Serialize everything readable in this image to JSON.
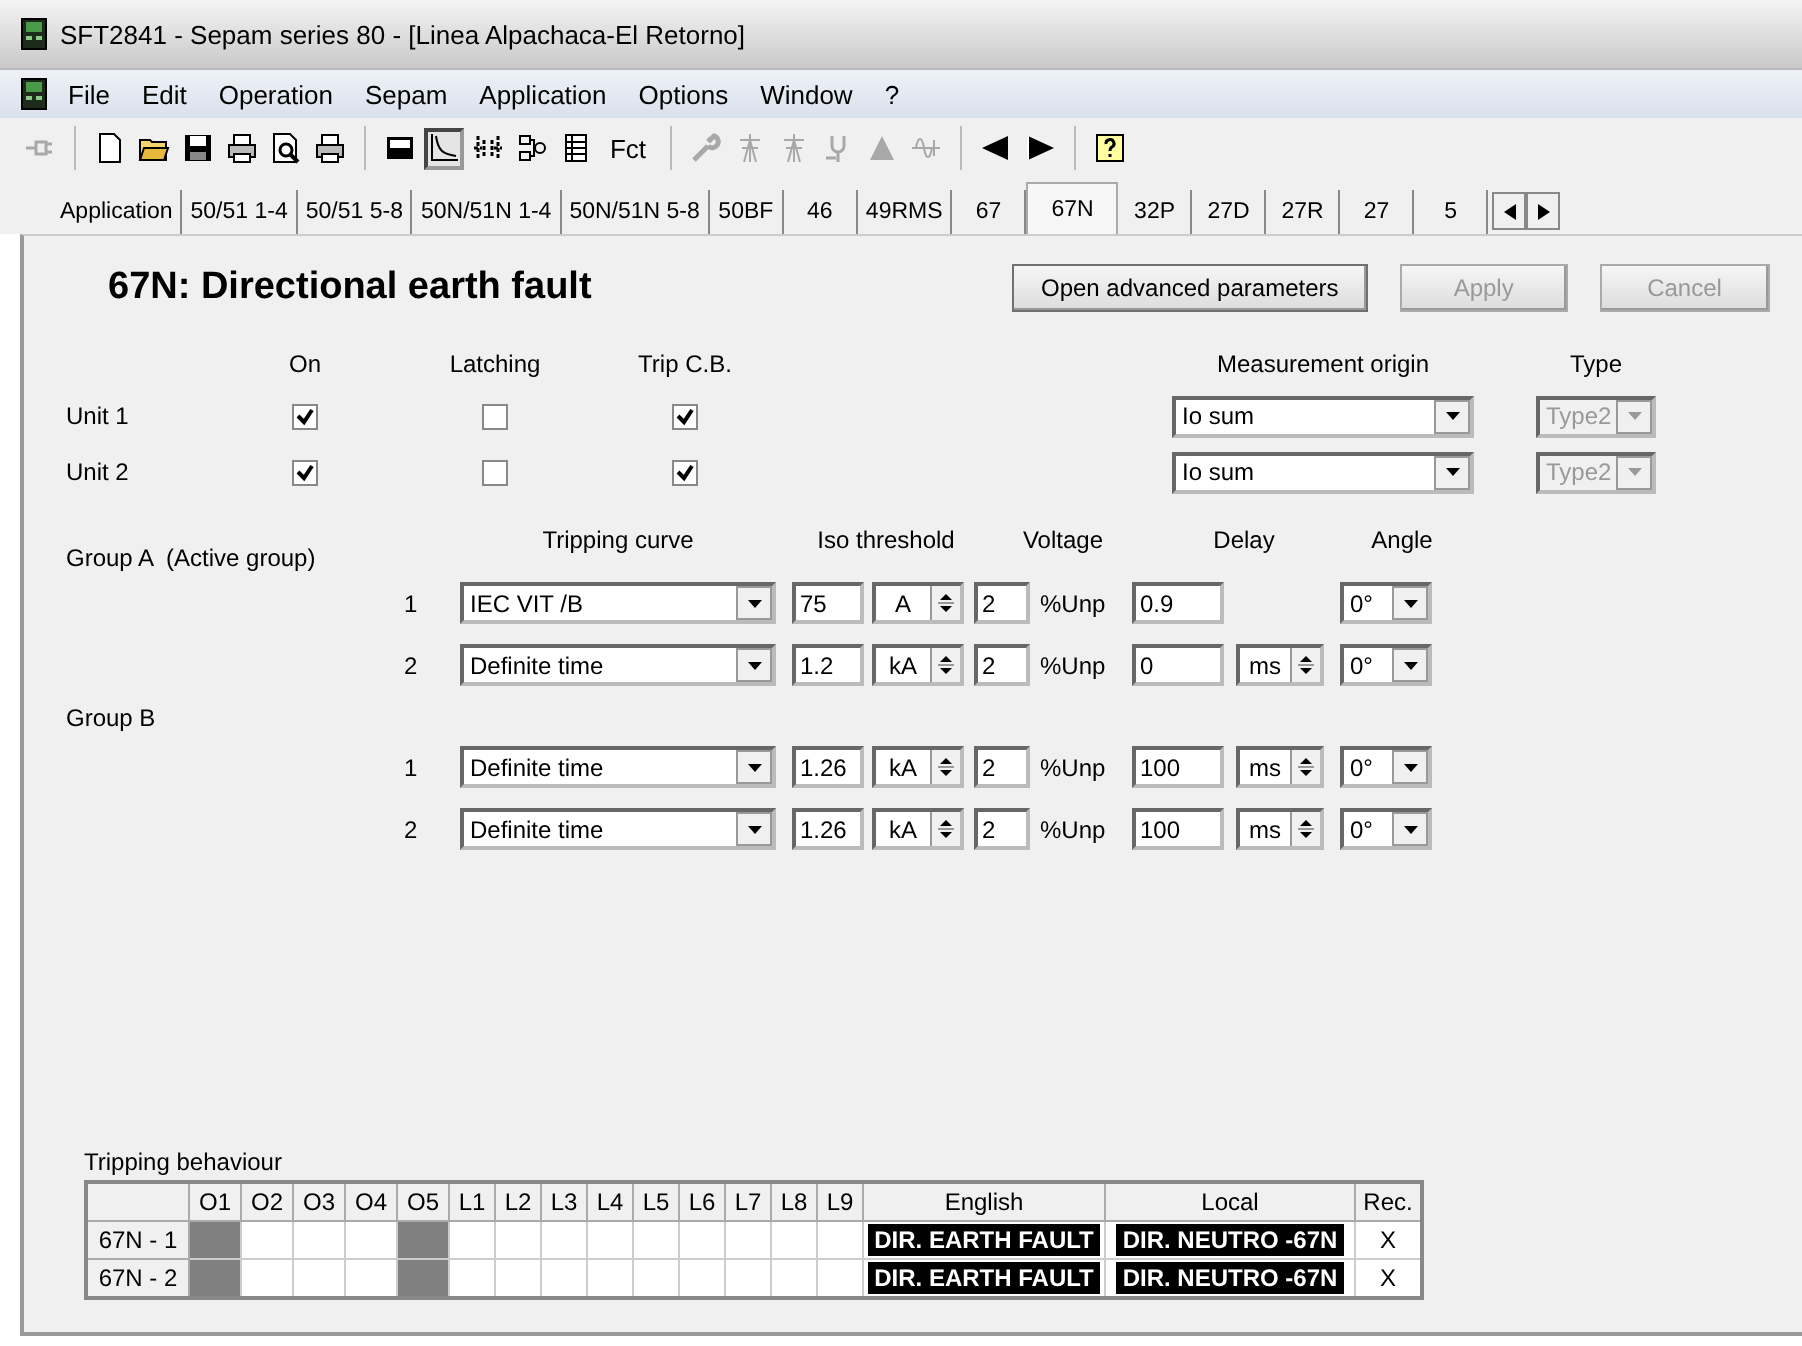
{
  "window": {
    "title": "SFT2841 - Sepam series 80 - [Linea Alpachaca-El Retorno]"
  },
  "menu": [
    "File",
    "Edit",
    "Operation",
    "Sepam",
    "Application",
    "Options",
    "Window",
    "?"
  ],
  "toolbar": [
    {
      "kind": "plug",
      "disabled": true,
      "selected": false
    },
    {
      "kind": "separator"
    },
    {
      "kind": "new",
      "disabled": false,
      "selected": false
    },
    {
      "kind": "open",
      "disabled": false,
      "selected": false
    },
    {
      "kind": "save",
      "disabled": false,
      "selected": false
    },
    {
      "kind": "print",
      "disabled": false,
      "selected": false
    },
    {
      "kind": "preview",
      "disabled": false,
      "selected": false
    },
    {
      "kind": "print",
      "disabled": false,
      "selected": false
    },
    {
      "kind": "separator"
    },
    {
      "kind": "device",
      "disabled": false,
      "selected": false
    },
    {
      "kind": "curve",
      "disabled": false,
      "selected": true
    },
    {
      "kind": "io",
      "disabled": false,
      "selected": false
    },
    {
      "kind": "logic",
      "disabled": false,
      "selected": false
    },
    {
      "kind": "table",
      "disabled": false,
      "selected": false
    },
    {
      "kind": "text",
      "label": "Fct",
      "disabled": false,
      "selected": false
    },
    {
      "kind": "separator"
    },
    {
      "kind": "wrench",
      "disabled": true,
      "selected": false
    },
    {
      "kind": "tower",
      "disabled": true,
      "selected": false
    },
    {
      "kind": "tower",
      "disabled": true,
      "selected": false
    },
    {
      "kind": "probe",
      "disabled": true,
      "selected": false
    },
    {
      "kind": "triangle",
      "disabled": true,
      "selected": false
    },
    {
      "kind": "wave",
      "disabled": true,
      "selected": false
    },
    {
      "kind": "separator"
    },
    {
      "kind": "back",
      "disabled": false,
      "selected": false
    },
    {
      "kind": "forward",
      "disabled": false,
      "selected": false
    },
    {
      "kind": "separator"
    },
    {
      "kind": "help",
      "disabled": false,
      "selected": false
    }
  ],
  "tabs": [
    {
      "label": "Application",
      "selected": false
    },
    {
      "label": "50/51 1-4",
      "selected": false
    },
    {
      "label": "50/51 5-8",
      "selected": false
    },
    {
      "label": "50N/51N 1-4",
      "selected": false
    },
    {
      "label": "50N/51N 5-8",
      "selected": false
    },
    {
      "label": "50BF",
      "selected": false
    },
    {
      "label": "46",
      "selected": false
    },
    {
      "label": "49RMS",
      "selected": false
    },
    {
      "label": "67",
      "selected": false
    },
    {
      "label": "67N",
      "selected": true
    },
    {
      "label": "32P",
      "selected": false
    },
    {
      "label": "27D",
      "selected": false
    },
    {
      "label": "27R",
      "selected": false
    },
    {
      "label": "27",
      "selected": false
    },
    {
      "label": "5",
      "selected": false
    }
  ],
  "panel": {
    "heading": "67N: Directional earth fault",
    "buttons": [
      {
        "label": "Open advanced parameters",
        "disabled": false
      },
      {
        "label": "Apply",
        "disabled": true
      },
      {
        "label": "Cancel",
        "disabled": true
      }
    ],
    "unit_columns": [
      "On",
      "Latching",
      "Trip C.B."
    ],
    "origin_header": "Measurement origin",
    "type_header": "Type",
    "units": [
      {
        "label": "Unit 1",
        "on": true,
        "latching": false,
        "trip_cb": true,
        "measurement_origin": "Io sum",
        "type": {
          "value": "Type2",
          "disabled": true
        }
      },
      {
        "label": "Unit 2",
        "on": true,
        "latching": false,
        "trip_cb": true,
        "measurement_origin": "Io sum",
        "type": {
          "value": "Type2",
          "disabled": true
        }
      }
    ],
    "group_columns": [
      "Tripping curve",
      "Iso threshold",
      "Voltage",
      "Delay",
      "Angle"
    ],
    "groups": [
      {
        "label": "Group A  (Active group)",
        "rows": [
          {
            "number": "1",
            "curve": "IEC VIT /B",
            "threshold": "75",
            "threshold_unit": "A",
            "voltage": "2",
            "voltage_unit": "%Unp",
            "delay": "0.9",
            "angle": "0°"
          },
          {
            "number": "2",
            "curve": "Definite time",
            "threshold": "1.2",
            "threshold_unit": "kA",
            "voltage": "2",
            "voltage_unit": "%Unp",
            "delay": "0",
            "delay_unit": "ms",
            "angle": "0°"
          }
        ]
      },
      {
        "label": "Group B",
        "rows": [
          {
            "number": "1",
            "curve": "Definite time",
            "threshold": "1.26",
            "threshold_unit": "kA",
            "voltage": "2",
            "voltage_unit": "%Unp",
            "delay": "100",
            "delay_unit": "ms",
            "angle": "0°"
          },
          {
            "number": "2",
            "curve": "Definite time",
            "threshold": "1.26",
            "threshold_unit": "kA",
            "voltage": "2",
            "voltage_unit": "%Unp",
            "delay": "100",
            "delay_unit": "ms",
            "angle": "0°"
          }
        ]
      }
    ],
    "tripping": {
      "title": "Tripping behaviour",
      "columns": [
        "O1",
        "O2",
        "O3",
        "O4",
        "O5",
        "L1",
        "L2",
        "L3",
        "L4",
        "L5",
        "L6",
        "L7",
        "L8",
        "L9",
        "English",
        "Local",
        "Rec."
      ],
      "rows": [
        {
          "label": "67N - 1",
          "outputs": [
            true,
            false,
            false,
            false,
            true,
            false,
            false,
            false,
            false,
            false,
            false,
            false,
            false,
            false
          ],
          "english": "DIR. EARTH FAULT",
          "local": "DIR. NEUTRO -67N",
          "rec": "X"
        },
        {
          "label": "67N - 2",
          "outputs": [
            true,
            false,
            false,
            false,
            true,
            false,
            false,
            false,
            false,
            false,
            false,
            false,
            false,
            false
          ],
          "english": "DIR. EARTH FAULT",
          "local": "DIR. NEUTRO -67N",
          "rec": "X"
        }
      ]
    }
  }
}
